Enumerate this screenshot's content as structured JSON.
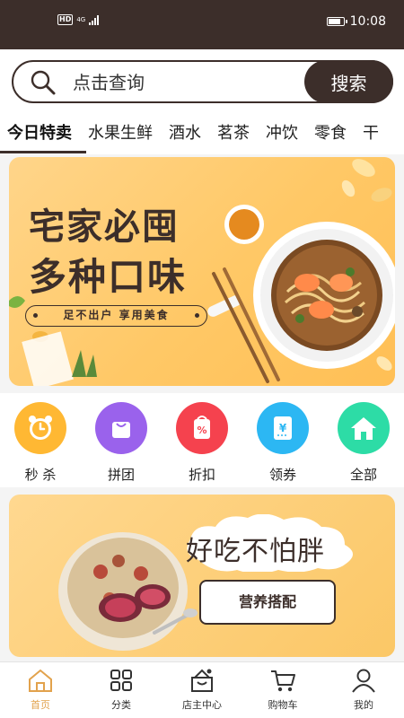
{
  "status_bar": {
    "hd": "HD",
    "network": "4G",
    "time": "10:08",
    "battery_level": 0.85
  },
  "search": {
    "icon": "search-icon",
    "placeholder": "点击查询",
    "button_label": "搜索"
  },
  "tabs": [
    {
      "label": "今日特卖",
      "active": true
    },
    {
      "label": "水果生鲜"
    },
    {
      "label": "酒水"
    },
    {
      "label": "茗茶"
    },
    {
      "label": "冲饮"
    },
    {
      "label": "零食"
    },
    {
      "label": "干"
    }
  ],
  "banner": {
    "title_line1": "宅家必囤",
    "title_line2": "多种口味",
    "slogan": "足不出户 享用美食"
  },
  "categories": [
    {
      "label": "秒 杀",
      "icon": "alarm-clock-icon",
      "color": "#ffb833"
    },
    {
      "label": "拼团",
      "icon": "shopping-bag-icon",
      "color": "#9a62ec"
    },
    {
      "label": "折扣",
      "icon": "discount-tag-icon",
      "color": "#f5424e"
    },
    {
      "label": "领券",
      "icon": "coupon-icon",
      "color": "#2cb7f3"
    },
    {
      "label": "全部",
      "icon": "home-icon",
      "color": "#2ddca6"
    }
  ],
  "promo": {
    "headline": "好吃不怕胖",
    "button_label": "营养搭配"
  },
  "bottom_nav": [
    {
      "label": "首页",
      "icon": "home-outline-icon",
      "active": true
    },
    {
      "label": "分类",
      "icon": "grid-icon"
    },
    {
      "label": "店主中心",
      "icon": "shop-icon"
    },
    {
      "label": "购物车",
      "icon": "cart-icon"
    },
    {
      "label": "我的",
      "icon": "user-icon"
    }
  ],
  "colors": {
    "primary_dark": "#3c2e2a",
    "accent_gold": "#e2a24c",
    "banner_yellow": "#ffc866"
  }
}
